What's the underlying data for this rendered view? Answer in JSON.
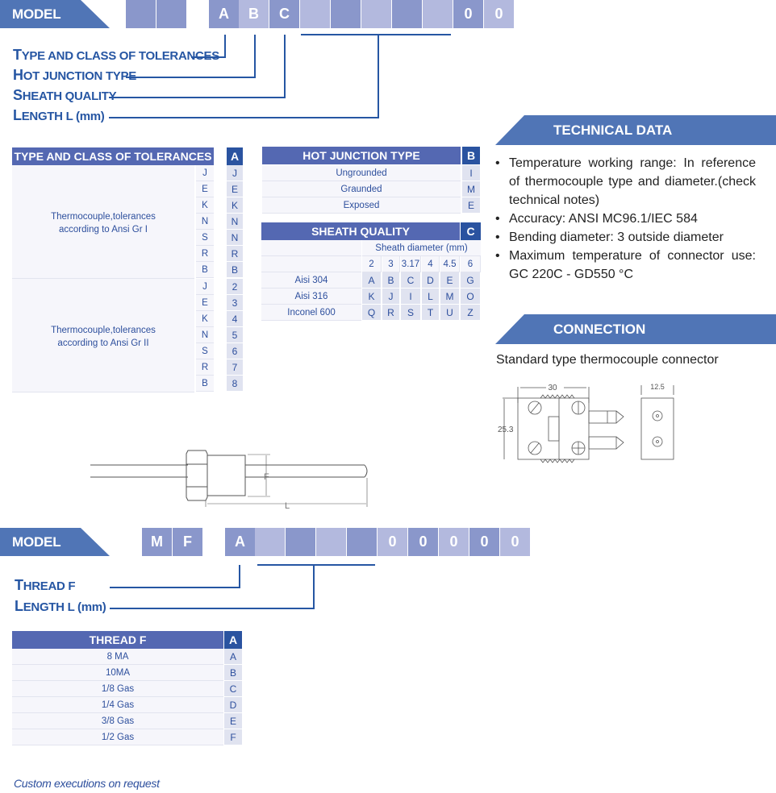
{
  "model1": {
    "label": "MODEL",
    "boxes": [
      "",
      "",
      "A",
      "B",
      "C",
      "",
      "",
      "",
      "",
      "",
      "0",
      "0"
    ],
    "legend": [
      {
        "first": "T",
        "rest": "YPE AND CLASS OF TOLERANCES"
      },
      {
        "first": "H",
        "rest": "OT JUNCTION TYPE"
      },
      {
        "first": "S",
        "rest": "HEATH QUALITY"
      },
      {
        "first": "L",
        "rest": "ENGTH L (mm)"
      }
    ]
  },
  "tolerances": {
    "title": "TYPE AND CLASS OF TOLERANCES",
    "code_header": "A",
    "groups": [
      {
        "desc_line1": "Thermocouple,tolerances",
        "desc_line2": "according to Ansi Gr I",
        "types": [
          "J",
          "E",
          "K",
          "N",
          "S",
          "R",
          "B"
        ],
        "codes": [
          "J",
          "E",
          "K",
          "N",
          "N",
          "R",
          "B"
        ]
      },
      {
        "desc_line1": "Thermocouple,tolerances",
        "desc_line2": "according to Ansi Gr II",
        "types": [
          "J",
          "E",
          "K",
          "N",
          "S",
          "R",
          "B"
        ],
        "codes": [
          "2",
          "3",
          "4",
          "5",
          "6",
          "7",
          "8"
        ]
      }
    ]
  },
  "hot_junction": {
    "title": "HOT JUNCTION TYPE",
    "code_header": "B",
    "rows": [
      {
        "label": "Ungrounded",
        "code": "I"
      },
      {
        "label": "Graunded",
        "code": "M"
      },
      {
        "label": "Exposed",
        "code": "E"
      }
    ]
  },
  "sheath": {
    "title": "SHEATH QUALITY",
    "code_header": "C",
    "diameter_header": "Sheath diameter (mm)",
    "diameters": [
      "2",
      "3",
      "3.17",
      "4",
      "4.5",
      "6"
    ],
    "rows": [
      {
        "label": "Aisi 304",
        "codes": [
          "A",
          "B",
          "C",
          "D",
          "E",
          "G"
        ]
      },
      {
        "label": "Aisi 316",
        "codes": [
          "K",
          "J",
          "I",
          "L",
          "M",
          "O"
        ]
      },
      {
        "label": "Inconel 600",
        "codes": [
          "Q",
          "R",
          "S",
          "T",
          "U",
          "Z"
        ]
      }
    ]
  },
  "technical": {
    "title": "TECHNICAL DATA",
    "items": [
      "Temperature working range: In reference of thermocouple type and diameter.(check technical notes)",
      "Accuracy: ANSI MC96.1/IEC 584",
      "Bending diameter: 3  outside diameter",
      "Maximum temperature of connector use: GC 220C - GD550 °C"
    ]
  },
  "connection": {
    "title": "CONNECTION",
    "text": "Standard type thermocouple connector",
    "dims": {
      "width": "30",
      "height": "25.3",
      "depth": "12.5"
    }
  },
  "probe_drawing": {
    "thread_label": "F",
    "length_label": "L"
  },
  "model2": {
    "label": "MODEL",
    "boxes": [
      "M",
      "F",
      "A",
      "",
      "",
      "",
      "",
      "0",
      "0",
      "0",
      "0",
      "0"
    ],
    "legend": [
      {
        "first": "T",
        "rest": "HREAD F"
      },
      {
        "first": "L",
        "rest": "ENGTH L (mm)"
      }
    ]
  },
  "thread": {
    "title": "THREAD F",
    "code_header": "A",
    "rows": [
      {
        "label": "8 MA",
        "code": "A"
      },
      {
        "label": "10MA",
        "code": "B"
      },
      {
        "label": "1/8 Gas",
        "code": "C"
      },
      {
        "label": "1/4 Gas",
        "code": "D"
      },
      {
        "label": "3/8 Gas",
        "code": "E"
      },
      {
        "label": "1/2 Gas",
        "code": "F"
      }
    ]
  },
  "footer": {
    "note": "Custom executions on request"
  }
}
